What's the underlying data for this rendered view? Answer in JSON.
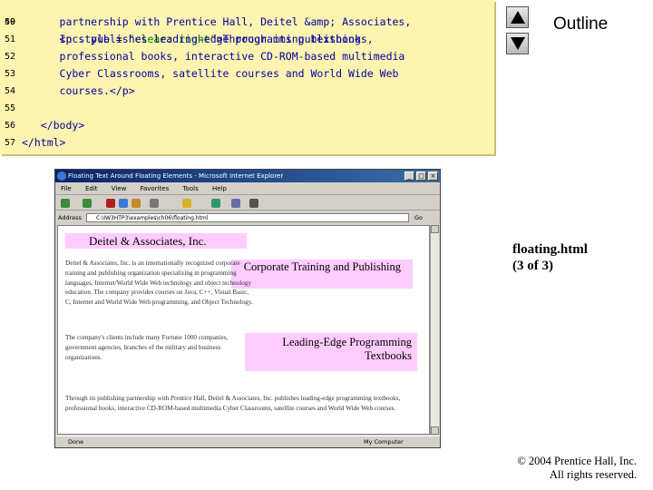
{
  "code": {
    "lines": [
      {
        "no": "49",
        "pre": "",
        "kw": "<p style",
        "mid": " = ",
        "str": "\"clear: right\"",
        "post": ">Through its publishing",
        "indent": "      "
      },
      {
        "no": "50",
        "text": "      partnership with Prentice Hall, Deitel &amp; Associates,"
      },
      {
        "no": "51",
        "text": "      Inc. publishes leading-edge programming textbooks,"
      },
      {
        "no": "52",
        "text": "      professional books, interactive CD-ROM-based multimedia"
      },
      {
        "no": "53",
        "text": "      Cyber Classrooms, satellite courses and World Wide Web"
      },
      {
        "no": "54",
        "text": "      courses.</p>"
      },
      {
        "no": "55",
        "text": ""
      },
      {
        "no": "56",
        "text": "   </body>"
      },
      {
        "no": "57",
        "text": "</html>"
      }
    ]
  },
  "nav": {
    "outline_label": "Outline",
    "up_icon": "triangle-up-icon",
    "down_icon": "triangle-down-icon"
  },
  "caption": {
    "filename": "floating.html",
    "page": "(3 of 3)"
  },
  "footer": {
    "copyright": "© 2004 Prentice Hall, Inc.",
    "rights": "All rights reserved."
  },
  "browser": {
    "title": "Floating Text Around Floating Elements - Microsoft Internet Explorer",
    "menu": [
      "File",
      "Edit",
      "View",
      "Favorites",
      "Tools",
      "Help"
    ],
    "address_label": "Address",
    "address_value": "C:\\IW3HTP3\\examples\\ch06\\floating.html",
    "go_label": "Go",
    "status_left": "Done",
    "status_right": "My Computer",
    "page": {
      "heading": "Deitel & Associates, Inc.",
      "float1": "Corporate Training and Publishing",
      "para1": "Deitel & Associates, Inc. is an internationally recognized corporate training and publishing organization specializing in programming languages, Internet/World Wide Web technology and object technology education. The company provides courses on Java, C++, Visual Basic, C, Internet and World Wide Web programming, and Object Technology.",
      "float2": "Leading-Edge Programming Textbooks",
      "para2": "The company's clients include many Fortune 1000 companies, government agencies, branches of the military and business organizations.",
      "para3": "Through its publishing partnership with Prentice Hall, Deitel & Associates, Inc. publishes leading-edge programming textbooks, professional books, interactive CD-ROM-based multimedia Cyber Classrooms, satellite courses and World Wide Web courses."
    }
  },
  "colors": {
    "code_bg": "#fdf4b0",
    "float_bg": "#ffccff"
  }
}
